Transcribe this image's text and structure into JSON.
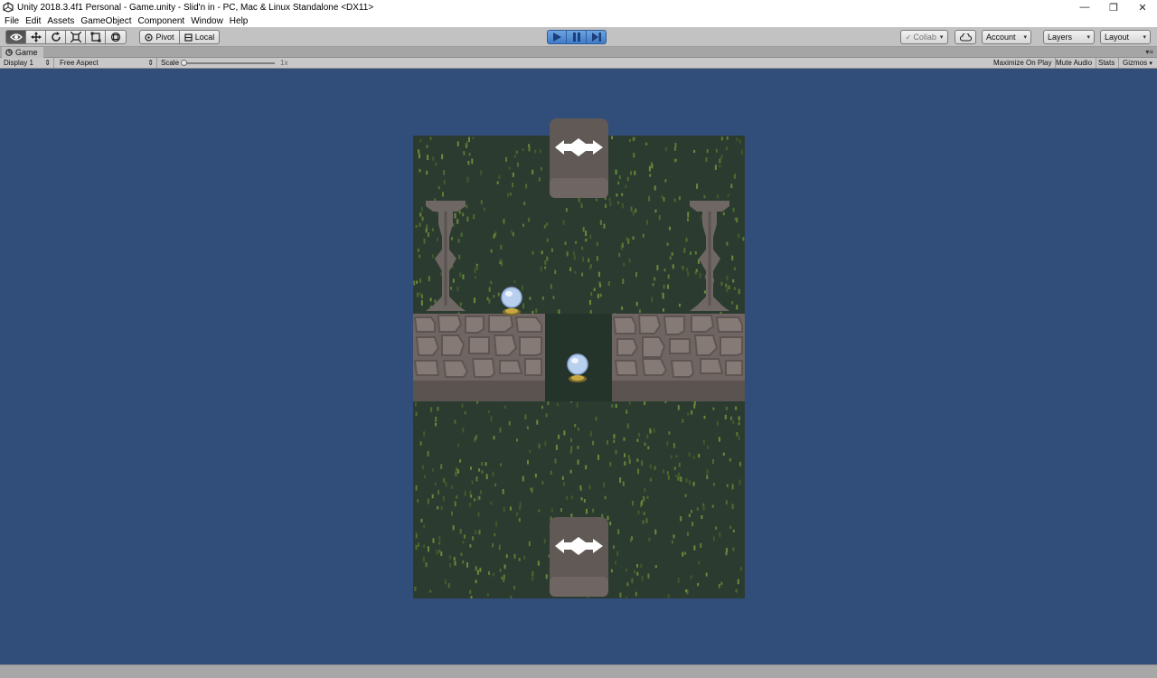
{
  "window": {
    "title": "Unity 2018.3.4f1 Personal - Game.unity - Slid'n in - PC, Mac & Linux Standalone <DX11>",
    "minimize_glyph": "—",
    "restore_glyph": "❐",
    "close_glyph": "✕"
  },
  "menubar": {
    "items": [
      "File",
      "Edit",
      "Assets",
      "GameObject",
      "Component",
      "Window",
      "Help"
    ]
  },
  "toolbar": {
    "tools": [
      "view-tool-icon",
      "move-tool-icon",
      "rotate-tool-icon",
      "scale-tool-icon",
      "rect-tool-icon",
      "transform-tool-icon"
    ],
    "pivot_label": "Pivot",
    "local_label": "Local",
    "collab_label": "Collab",
    "account_label": "Account",
    "layers_label": "Layers",
    "layout_label": "Layout",
    "dropdown_arrow": "▾",
    "play_state": "playing",
    "accent_color": "#3f7bc8"
  },
  "game_tab": {
    "label": "Game",
    "menu_glyph": "▾≡"
  },
  "game_bar": {
    "display": "Display 1",
    "aspect": "Free Aspect",
    "scale_label": "Scale",
    "scale_value": "1x",
    "maximize": "Maximize On Play",
    "mute": "Mute Audio",
    "stats": "Stats",
    "gizmos": "Gizmos",
    "arrow": "⇕",
    "gizmos_arrow": "▾"
  },
  "scene": {
    "background_color": "#314d79",
    "grass_color": "#2c3b30",
    "objects": [
      "door-top",
      "door-bottom",
      "pillar-left",
      "pillar-right",
      "wall-left",
      "wall-right",
      "orb-left",
      "orb-center"
    ]
  }
}
